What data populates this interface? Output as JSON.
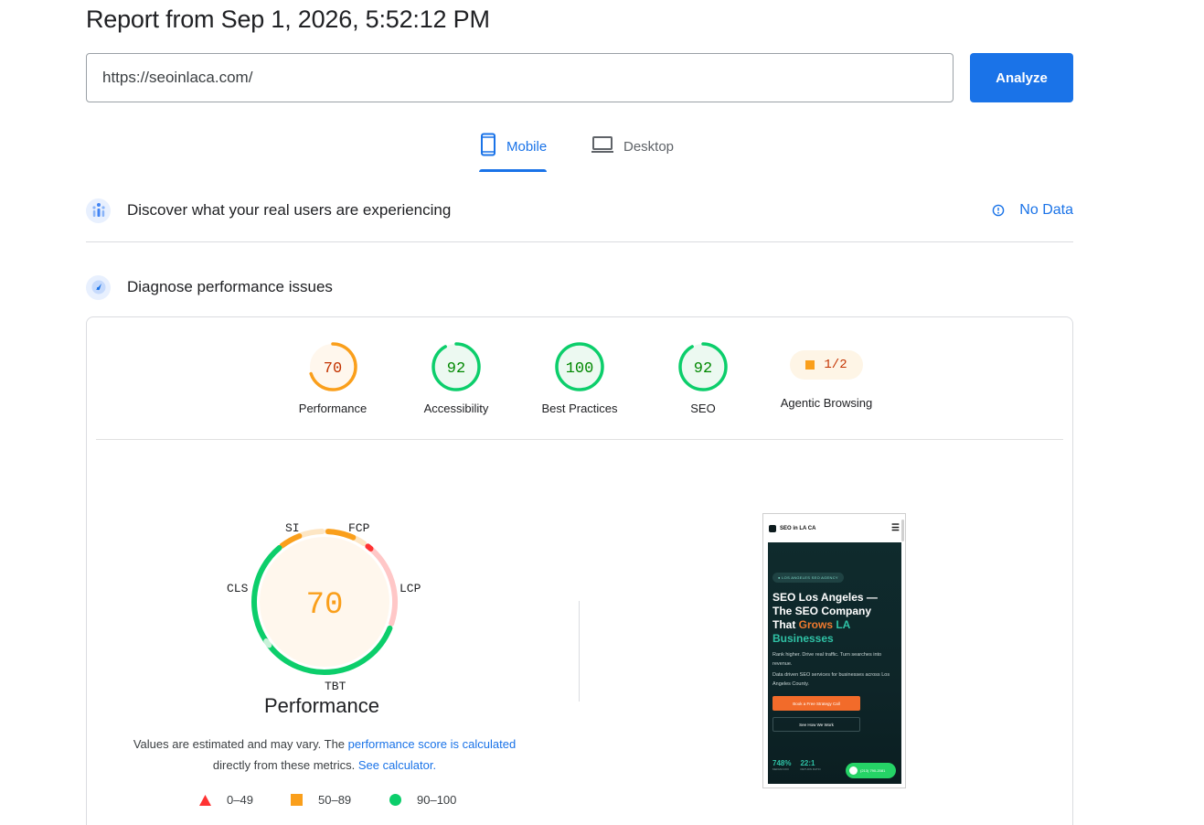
{
  "header": {
    "title": "Report from Sep 1, 2026, 5:52:12 PM"
  },
  "search": {
    "url": "https://seoinlaca.com/",
    "analyze_label": "Analyze"
  },
  "tabs": [
    {
      "label": "Mobile",
      "active": true
    },
    {
      "label": "Desktop",
      "active": false
    }
  ],
  "field_data": {
    "title": "Discover what your real users are experiencing",
    "status": "No Data"
  },
  "diagnose": {
    "title": "Diagnose performance issues"
  },
  "categories": [
    {
      "name": "Performance",
      "score": "70",
      "status": "average",
      "color": "#fa9f1b",
      "text_color": "#c33300",
      "fill": "#fff7ed"
    },
    {
      "name": "Accessibility",
      "score": "92",
      "status": "pass",
      "color": "#0cce6b",
      "text_color": "#008800",
      "fill": "#ecf9f1"
    },
    {
      "name": "Best Practices",
      "score": "100",
      "status": "pass",
      "color": "#0cce6b",
      "text_color": "#008800",
      "fill": "#ecf9f1"
    },
    {
      "name": "SEO",
      "score": "92",
      "status": "pass",
      "color": "#0cce6b",
      "text_color": "#008800",
      "fill": "#ecf9f1"
    }
  ],
  "agentic": {
    "name": "Agentic Browsing",
    "score": "1/2"
  },
  "perf_gauge": {
    "score": "70",
    "title": "Performance",
    "metrics": [
      "SI",
      "FCP",
      "LCP",
      "TBT",
      "CLS"
    ]
  },
  "note": {
    "text1": "Values are estimated and may vary. The ",
    "link1": "performance score is calculated",
    "text2": " directly from these metrics. ",
    "link2": "See calculator."
  },
  "legend": [
    {
      "range": "0–49",
      "shape": "triangle",
      "color": "#ff3333"
    },
    {
      "range": "50–89",
      "shape": "square",
      "color": "#fa9f1b"
    },
    {
      "range": "90–100",
      "shape": "circle",
      "color": "#0cce6b"
    }
  ],
  "screenshot": {
    "brand": "SEO in LA CA",
    "pill": "● LOS ANGELES SEO AGENCY",
    "headline_1": "SEO Los Angeles — The SEO Company That ",
    "headline_orange": "Grows",
    "headline_teal": " LA Businesses",
    "para1": "Rank higher. Drive real traffic. Turn searches into revenue.",
    "para2": "Data driven SEO services for businesses across Los Angeles County.",
    "cta_primary": "Book a Free Strategy Call",
    "cta_secondary": "See How We Work",
    "stat1": "748%",
    "stat1_sub": "MEDIAN ROI",
    "stat2": "22:1",
    "stat2_sub": "RETURN RATIO",
    "whatsapp": "(213) 790-2081"
  }
}
